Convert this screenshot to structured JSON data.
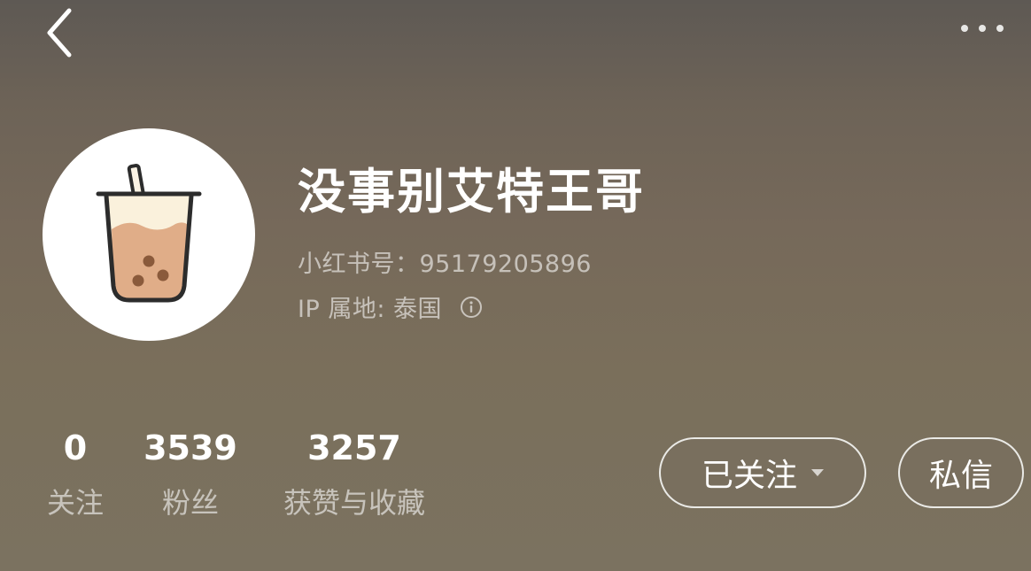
{
  "topbar": {
    "back_icon": "chevron-left-icon",
    "more_icon": "more-horizontal-icon"
  },
  "profile": {
    "nickname": "没事别艾特王哥",
    "id_line": "小红书号：95179205896",
    "ip_line": "IP 属地: 泰国",
    "avatar_icon": "bubble-tea-icon"
  },
  "stats": [
    {
      "value": "0",
      "label": "关注"
    },
    {
      "value": "3539",
      "label": "粉丝"
    },
    {
      "value": "3257",
      "label": "获赞与收藏"
    }
  ],
  "actions": {
    "follow_label": "已关注",
    "message_label": "私信"
  },
  "colors": {
    "background_top": "#5e5954",
    "background_bottom": "#7b7260",
    "tea_fill": "#e0ad88",
    "pearl": "#8a5a3b",
    "cup_outline": "#2c2c2c"
  }
}
